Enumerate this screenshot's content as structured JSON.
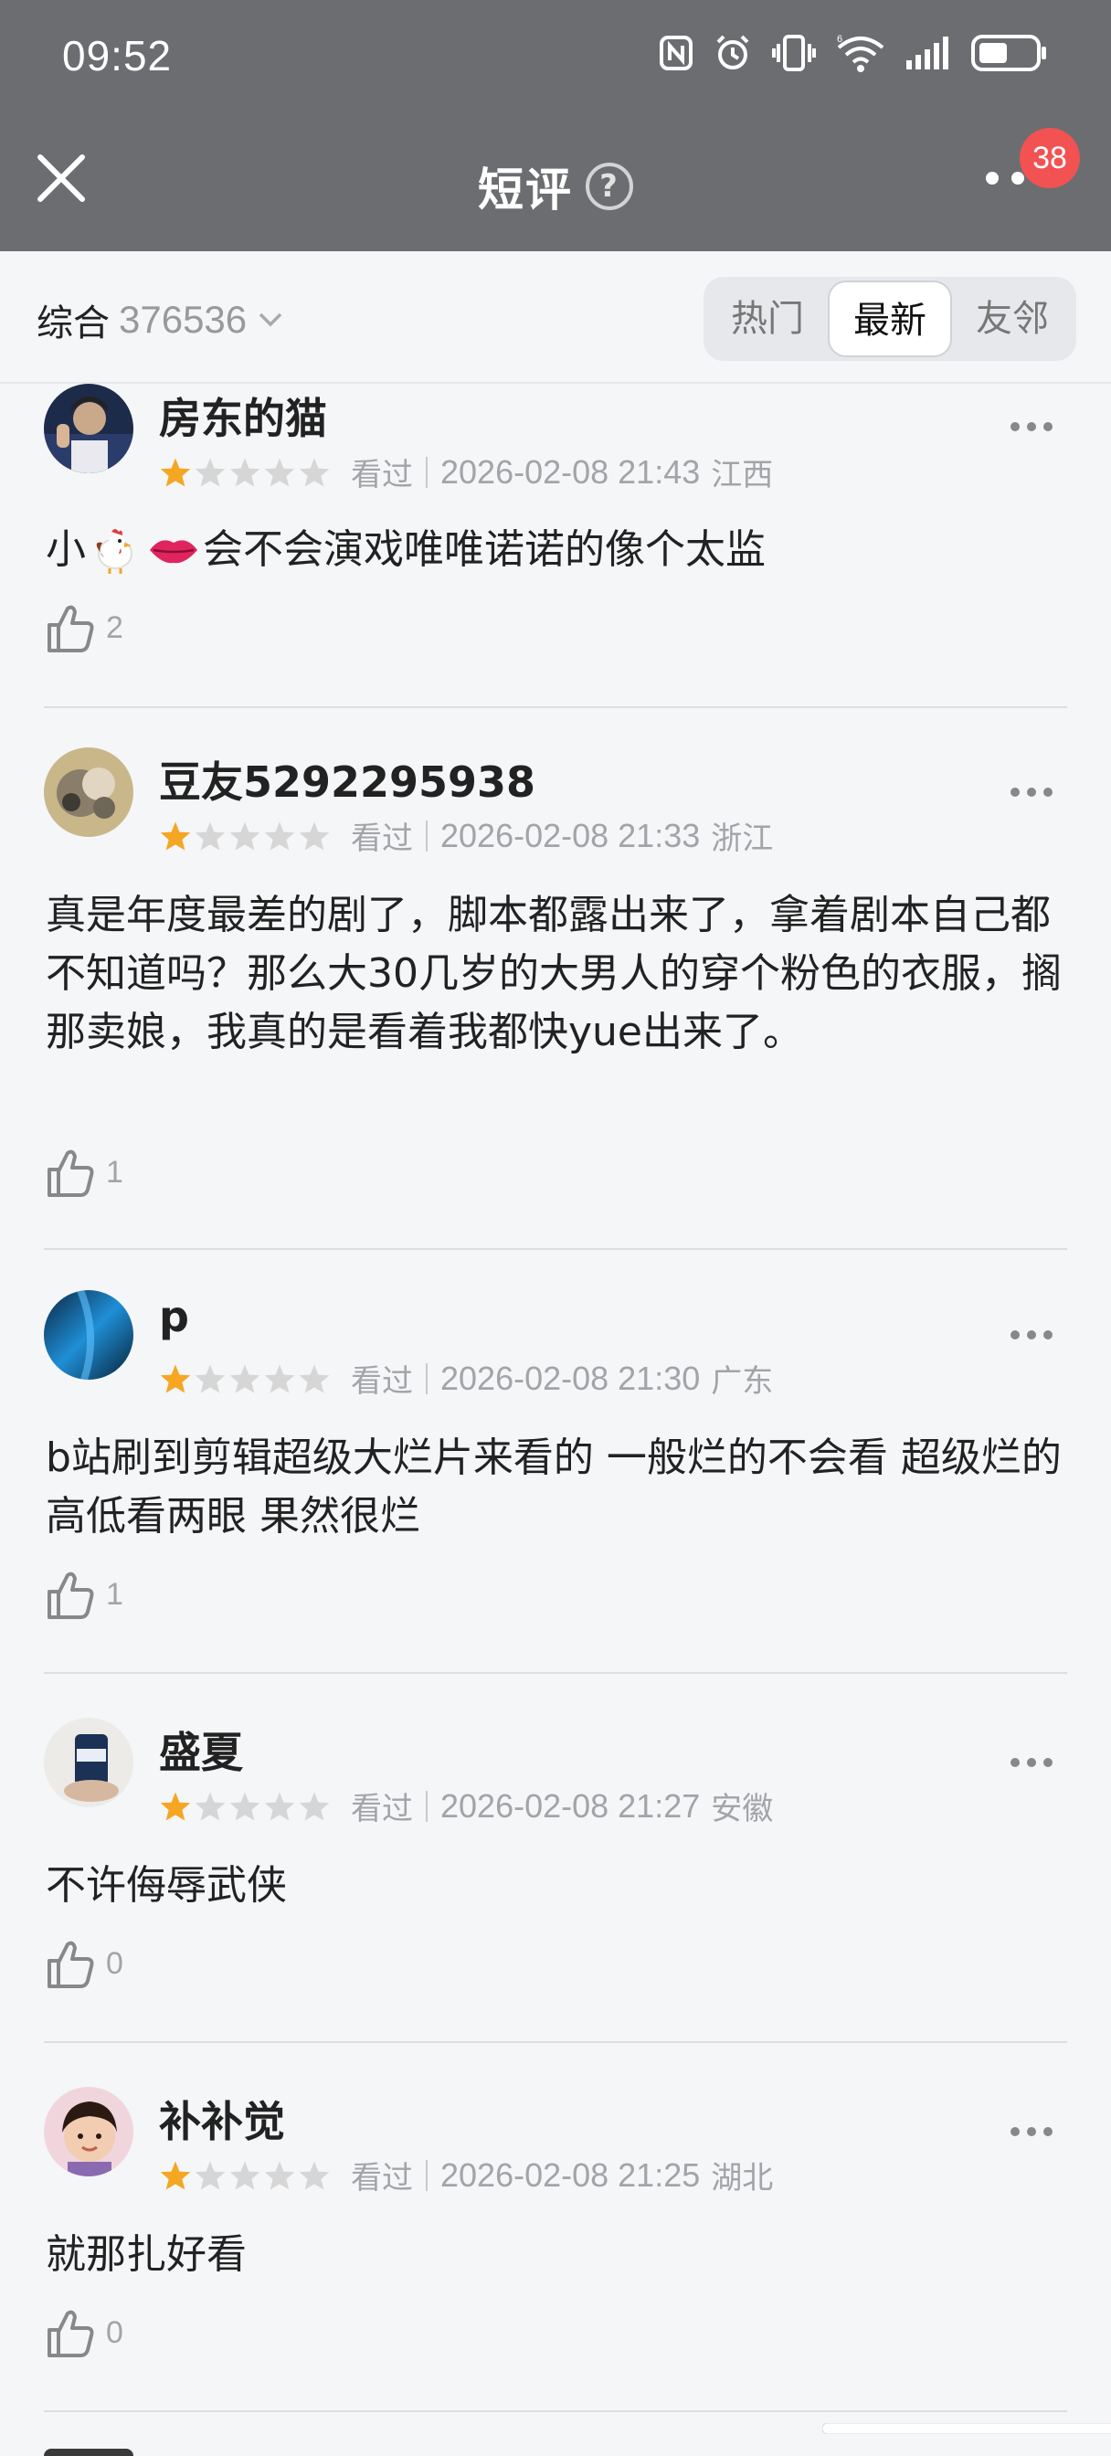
{
  "status_bar": {
    "time": "09:52"
  },
  "nav": {
    "title": "短评",
    "help_icon": "?",
    "badge": "38"
  },
  "filter": {
    "sort_label": "综合",
    "count": "376536",
    "tabs": [
      {
        "label": "热门",
        "active": false
      },
      {
        "label": "最新",
        "active": true
      },
      {
        "label": "友邻",
        "active": false
      }
    ]
  },
  "colors": {
    "star_on": "#f5a623",
    "star_off": "#d6d6d6",
    "badge": "#f25252",
    "header": "#6c6d70"
  },
  "reviews": [
    {
      "user": "房东的猫",
      "rating": 1,
      "watched": "看过",
      "datetime": "2026-02-08 21:43",
      "location": "江西",
      "text_a": "小",
      "text_b": "会不会演戏唯唯诺诺的像个太监",
      "likes": "2"
    },
    {
      "user": "豆友5292295938",
      "rating": 1,
      "watched": "看过",
      "datetime": "2026-02-08 21:33",
      "location": "浙江",
      "text": "真是年度最差的剧了，脚本都露出来了，拿着剧本自己都不知道吗？那么大30几岁的大男人的穿个粉色的衣服，搁那卖娘，我真的是看着我都快yue出来了。",
      "likes": "1"
    },
    {
      "user": "p",
      "rating": 1,
      "watched": "看过",
      "datetime": "2026-02-08 21:30",
      "location": "广东",
      "text": "b站刷到剪辑超级大烂片来看的 一般烂的不会看 超级烂的高低看两眼 果然很烂",
      "likes": "1"
    },
    {
      "user": "盛夏",
      "rating": 1,
      "watched": "看过",
      "datetime": "2026-02-08 21:27",
      "location": "安徽",
      "text": "不许侮辱武侠",
      "likes": "0"
    },
    {
      "user": "补补觉",
      "rating": 1,
      "watched": "看过",
      "datetime": "2026-02-08 21:25",
      "location": "湖北",
      "text": "就那扎好看",
      "likes": "0"
    }
  ]
}
